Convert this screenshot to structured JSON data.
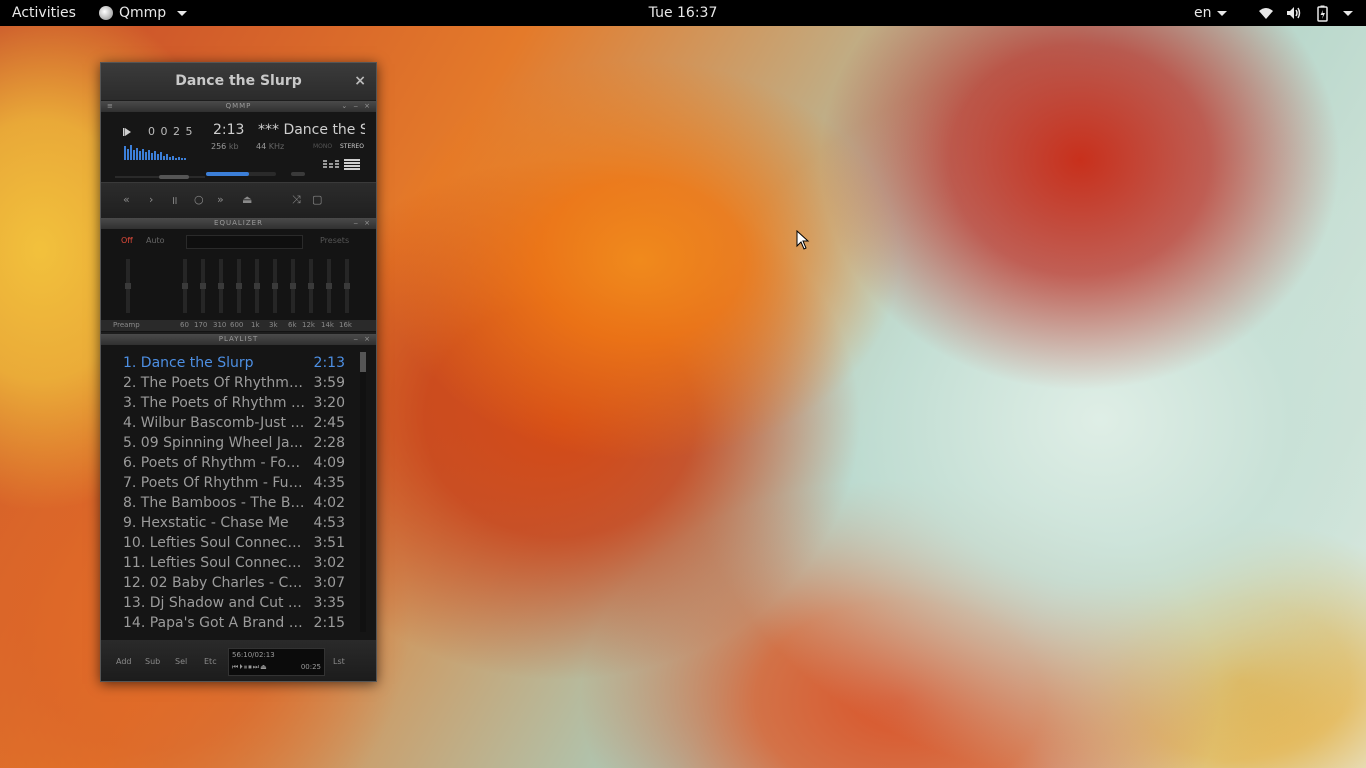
{
  "topbar": {
    "activities": "Activities",
    "app_name": "Qmmp",
    "clock": "Tue 16:37",
    "lang": "en",
    "tray_icons": [
      "wifi-icon",
      "volume-icon",
      "battery-icon",
      "system-menu-icon"
    ]
  },
  "window": {
    "title": "Dance the Slurp",
    "close": "×"
  },
  "main_bar": {
    "label": "QMMP"
  },
  "player": {
    "counter": "0 0 2 5",
    "time": "2:13",
    "ticker": "*** Dance the S",
    "bitrate": "256",
    "bitrate_unit": "kb",
    "samplerate": "44",
    "samplerate_unit": "KHz",
    "mono": "MONO",
    "stereo": "STEREO",
    "volume_level": 0.62
  },
  "controls": {
    "prev": "«",
    "play": "›",
    "pause": "॥",
    "stop": "○",
    "next": "»",
    "eject": "⏏",
    "shuffle": "⤨",
    "repeat": "▢"
  },
  "equalizer": {
    "label": "EQUALIZER",
    "off": "Off",
    "auto": "Auto",
    "presets": "Presets",
    "preamp": "Preamp",
    "bands": [
      "60",
      "170",
      "310",
      "600",
      "1k",
      "3k",
      "6k",
      "12k",
      "14k",
      "16k"
    ]
  },
  "playlist": {
    "label": "PLAYLIST",
    "items": [
      {
        "title": "1. Dance the Slurp",
        "duration": "2:13"
      },
      {
        "title": "2. The Poets Of Rhythm -...",
        "duration": "3:59"
      },
      {
        "title": "3. The Poets of Rhythm - ...",
        "duration": "3:20"
      },
      {
        "title": "4. Wilbur Bascomb-Just A...",
        "duration": "2:45"
      },
      {
        "title": "5. 09 Spinning Wheel Ja...",
        "duration": "2:28"
      },
      {
        "title": "6. Poets of Rhythm - Fon...",
        "duration": "4:09"
      },
      {
        "title": "7. Poets Of Rhythm - Fun...",
        "duration": "4:35"
      },
      {
        "title": "8. The Bamboos - The Ba...",
        "duration": "4:02"
      },
      {
        "title": "9. Hexstatic - Chase Me",
        "duration": "4:53"
      },
      {
        "title": "10. Lefties Soul Connecti...",
        "duration": "3:51"
      },
      {
        "title": "11. Lefties Soul Connecti...",
        "duration": "3:02"
      },
      {
        "title": "12. 02 Baby Charles - Co...",
        "duration": "3:07"
      },
      {
        "title": "13. Dj Shadow and Cut C...",
        "duration": "3:35"
      },
      {
        "title": "14. Papa's Got A Brand N...",
        "duration": "2:15"
      }
    ],
    "footer": {
      "add": "Add",
      "sub": "Sub",
      "sel": "Sel",
      "etc": "Etc",
      "lst": "Lst",
      "total": "56:10/02:13",
      "elapsed": "00:25"
    }
  },
  "colors": {
    "accent": "#4d8fe3",
    "eq_off": "#e04a3a"
  }
}
